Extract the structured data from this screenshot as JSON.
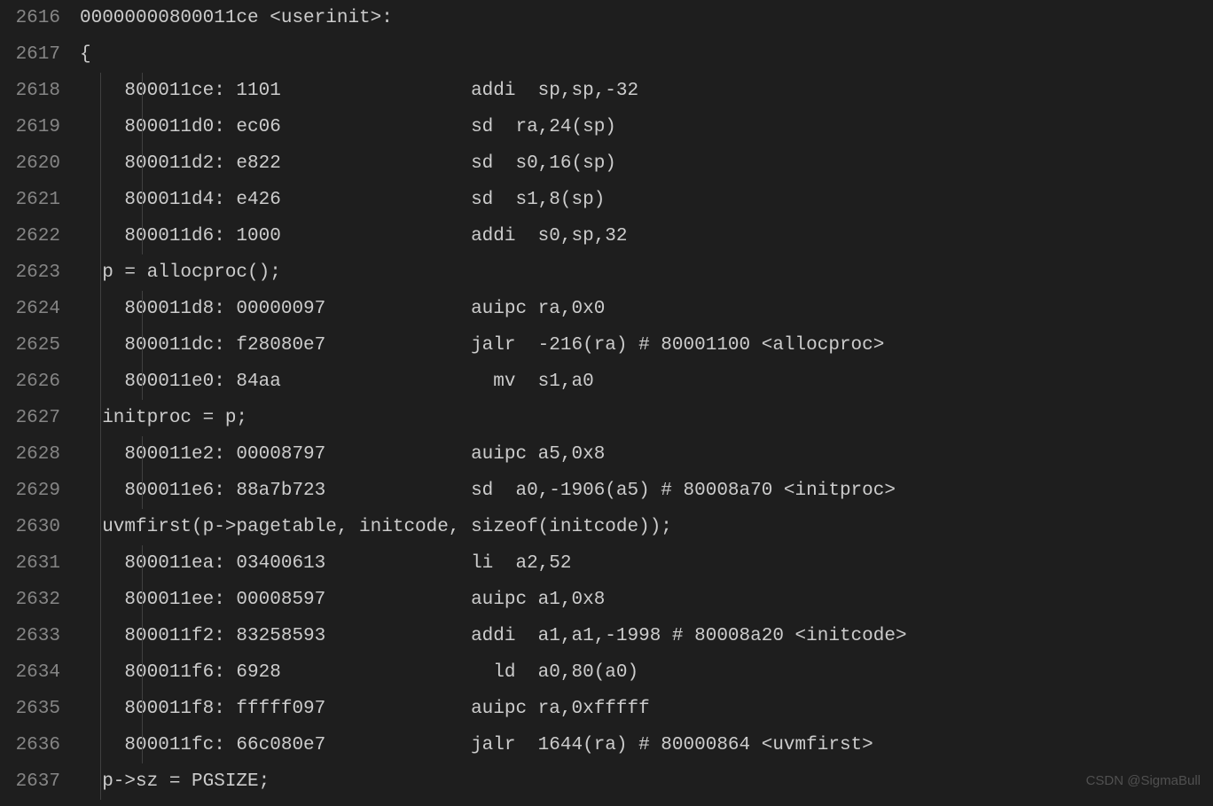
{
  "watermark": "CSDN @SigmaBull",
  "lines": [
    {
      "num": "2616",
      "text": "00000000800011ce <userinit>:",
      "i": 0
    },
    {
      "num": "2617",
      "text": "{",
      "i": 0
    },
    {
      "num": "2618",
      "text": "    800011ce: 1101                 addi  sp,sp,-32",
      "i": 2
    },
    {
      "num": "2619",
      "text": "    800011d0: ec06                 sd  ra,24(sp)",
      "i": 2
    },
    {
      "num": "2620",
      "text": "    800011d2: e822                 sd  s0,16(sp)",
      "i": 2
    },
    {
      "num": "2621",
      "text": "    800011d4: e426                 sd  s1,8(sp)",
      "i": 2
    },
    {
      "num": "2622",
      "text": "    800011d6: 1000                 addi  s0,sp,32",
      "i": 2
    },
    {
      "num": "2623",
      "text": "  p = allocproc();",
      "i": 1
    },
    {
      "num": "2624",
      "text": "    800011d8: 00000097             auipc ra,0x0",
      "i": 2
    },
    {
      "num": "2625",
      "text": "    800011dc: f28080e7             jalr  -216(ra) # 80001100 <allocproc>",
      "i": 2
    },
    {
      "num": "2626",
      "text": "    800011e0: 84aa                   mv  s1,a0",
      "i": 2
    },
    {
      "num": "2627",
      "text": "  initproc = p;",
      "i": 1
    },
    {
      "num": "2628",
      "text": "    800011e2: 00008797             auipc a5,0x8",
      "i": 2
    },
    {
      "num": "2629",
      "text": "    800011e6: 88a7b723             sd  a0,-1906(a5) # 80008a70 <initproc>",
      "i": 2
    },
    {
      "num": "2630",
      "text": "  uvmfirst(p->pagetable, initcode, sizeof(initcode));",
      "i": 1
    },
    {
      "num": "2631",
      "text": "    800011ea: 03400613             li  a2,52",
      "i": 2
    },
    {
      "num": "2632",
      "text": "    800011ee: 00008597             auipc a1,0x8",
      "i": 2
    },
    {
      "num": "2633",
      "text": "    800011f2: 83258593             addi  a1,a1,-1998 # 80008a20 <initcode>",
      "i": 2
    },
    {
      "num": "2634",
      "text": "    800011f6: 6928                   ld  a0,80(a0)",
      "i": 2
    },
    {
      "num": "2635",
      "text": "    800011f8: fffff097             auipc ra,0xfffff",
      "i": 2
    },
    {
      "num": "2636",
      "text": "    800011fc: 66c080e7             jalr  1644(ra) # 80000864 <uvmfirst>",
      "i": 2
    },
    {
      "num": "2637",
      "text": "  p->sz = PGSIZE;",
      "i": 1
    }
  ]
}
